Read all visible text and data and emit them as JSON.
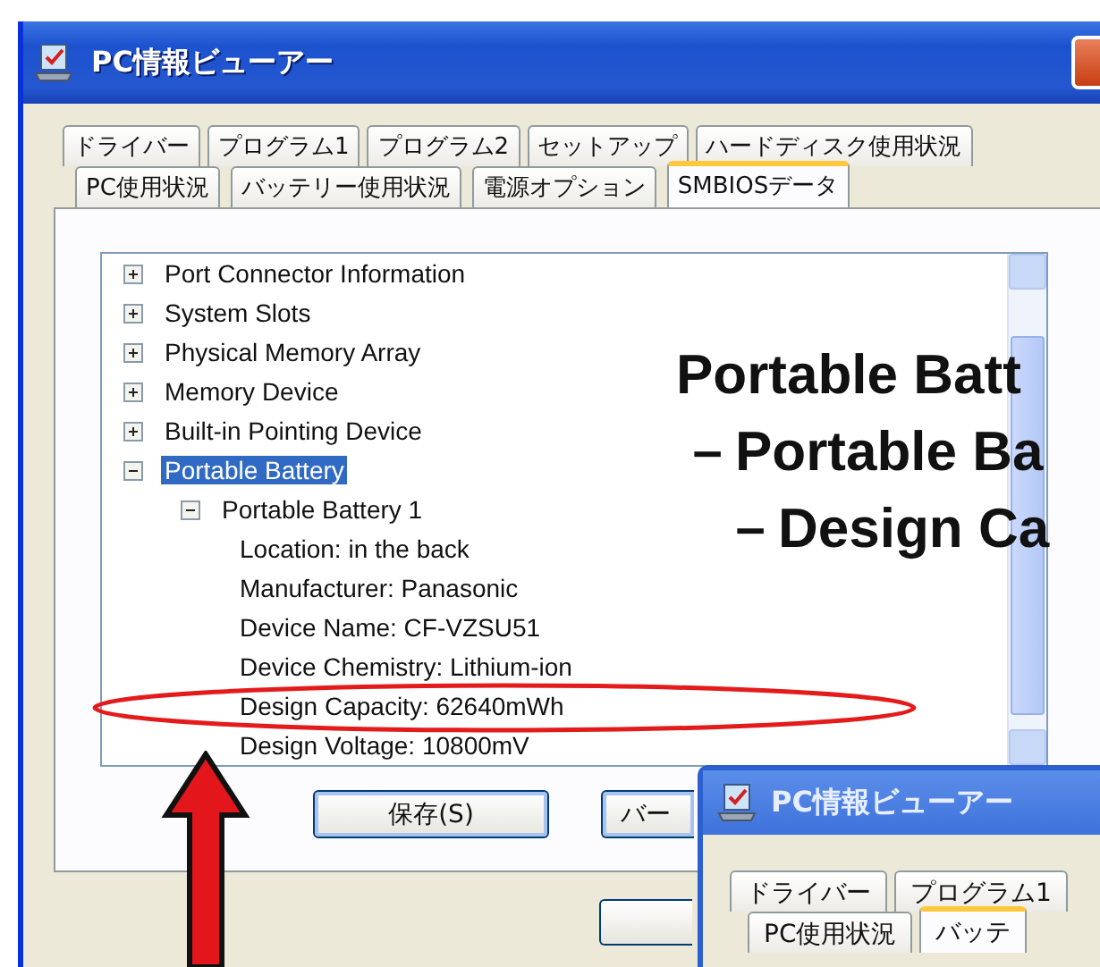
{
  "main_window": {
    "title": "PC情報ビューアー",
    "tab_rows": [
      [
        {
          "label": "ドライバー",
          "selected": false
        },
        {
          "label": "プログラム1",
          "selected": false
        },
        {
          "label": "プログラム2",
          "selected": false
        },
        {
          "label": "セットアップ",
          "selected": false
        },
        {
          "label": "ハードディスク使用状況",
          "selected": false
        }
      ],
      [
        {
          "label": "PC使用状況",
          "selected": false
        },
        {
          "label": "バッテリー使用状況",
          "selected": false
        },
        {
          "label": "電源オプション",
          "selected": false
        },
        {
          "label": "SMBIOSデータ",
          "selected": true
        }
      ]
    ],
    "tree": [
      {
        "label": "Port Connector Information",
        "expanded": false,
        "selected": false
      },
      {
        "label": "System Slots",
        "expanded": false,
        "selected": false
      },
      {
        "label": "Physical Memory Array",
        "expanded": false,
        "selected": false
      },
      {
        "label": "Memory Device",
        "expanded": false,
        "selected": false
      },
      {
        "label": "Built-in Pointing Device",
        "expanded": false,
        "selected": false
      },
      {
        "label": "Portable Battery",
        "expanded": true,
        "selected": true,
        "children": [
          {
            "label": "Portable Battery 1",
            "expanded": true,
            "selected": false,
            "children": [
              {
                "label": "Location: in the back",
                "selected": false
              },
              {
                "label": "Manufacturer: Panasonic",
                "selected": false
              },
              {
                "label": "Device Name: CF-VZSU51",
                "selected": false
              },
              {
                "label": "Device Chemistry: Lithium-ion",
                "selected": false
              },
              {
                "label": "Design Capacity: 62640mWh",
                "selected": false
              },
              {
                "label": "Design Voltage: 10800mV",
                "selected": false
              }
            ]
          }
        ]
      }
    ],
    "buttons": [
      "保存(S)",
      "バー"
    ]
  },
  "annotation": {
    "lines": [
      "Portable Batt",
      "－Portable Ba",
      "－Design Ca"
    ]
  },
  "second_window": {
    "title": "PC情報ビューアー",
    "tab_rows": [
      [
        {
          "label": "ドライバー",
          "selected": false
        },
        {
          "label": "プログラム1",
          "selected": false
        }
      ],
      [
        {
          "label": "PC使用状況",
          "selected": false
        },
        {
          "label": "バッテ",
          "selected": true
        }
      ]
    ]
  }
}
